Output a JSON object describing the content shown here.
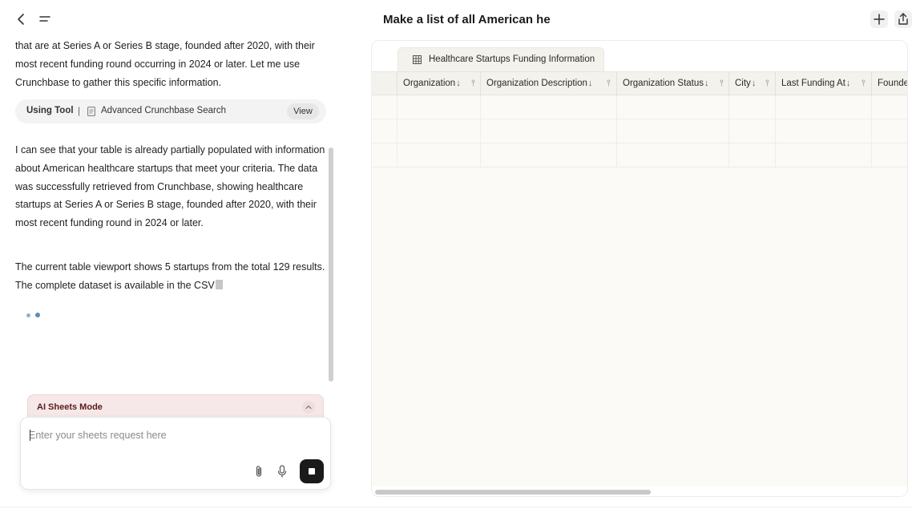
{
  "header": {
    "title": "Make a list of all American he"
  },
  "chat": {
    "intro_text": "that are at Series A or Series B stage, founded after 2020, with their most recent funding round occurring in 2024 or later. Let me use Crunchbase to gather this specific information.",
    "tool": {
      "label": "Using Tool",
      "separator": "|",
      "name": "Advanced Crunchbase Search",
      "view_label": "View"
    },
    "table_text": "I can see that your table is already partially populated with information about American healthcare startups that meet your criteria. The data was successfully retrieved from Crunchbase, showing healthcare startups at Series A or Series B stage, founded after 2020, with their most recent funding round in 2024 or later.",
    "viewport_text": "The current table viewport shows 5 startups from the total 129 results. The complete dataset is available in the CSV"
  },
  "mode_bar": {
    "label": "AI Sheets Mode"
  },
  "input": {
    "placeholder": "Enter your sheets request here",
    "value": ""
  },
  "sheet": {
    "tab_label": "Healthcare Startups Funding Information",
    "columns": [
      {
        "label": "Organization",
        "sort": "↓",
        "pin": "⫯"
      },
      {
        "label": "Organization Description",
        "sort": "↓",
        "pin": "⫯"
      },
      {
        "label": "Organization Status",
        "sort": "↓",
        "pin": "⫯"
      },
      {
        "label": "City",
        "sort": "↓",
        "pin": "⫯"
      },
      {
        "label": "Last Funding At",
        "sort": "↓",
        "pin": "⫯"
      },
      {
        "label": "Founde",
        "sort": "",
        "pin": ""
      }
    ],
    "rows_visible": 3
  },
  "icons": {
    "back": "chevron-left-icon",
    "menu": "menu-icon",
    "plus": "plus-icon",
    "share": "share-icon",
    "document": "document-icon",
    "grid": "table-grid-icon",
    "chevron_up": "chevron-up-icon",
    "attach": "paperclip-icon",
    "mic": "microphone-icon",
    "stop": "stop-icon"
  },
  "colors": {
    "mode_bar_bg": "#f6e8e8",
    "sheet_bg": "#fbfaf7",
    "stop_button": "#1a1a1a",
    "loading_dot": "#5f8fb0"
  }
}
